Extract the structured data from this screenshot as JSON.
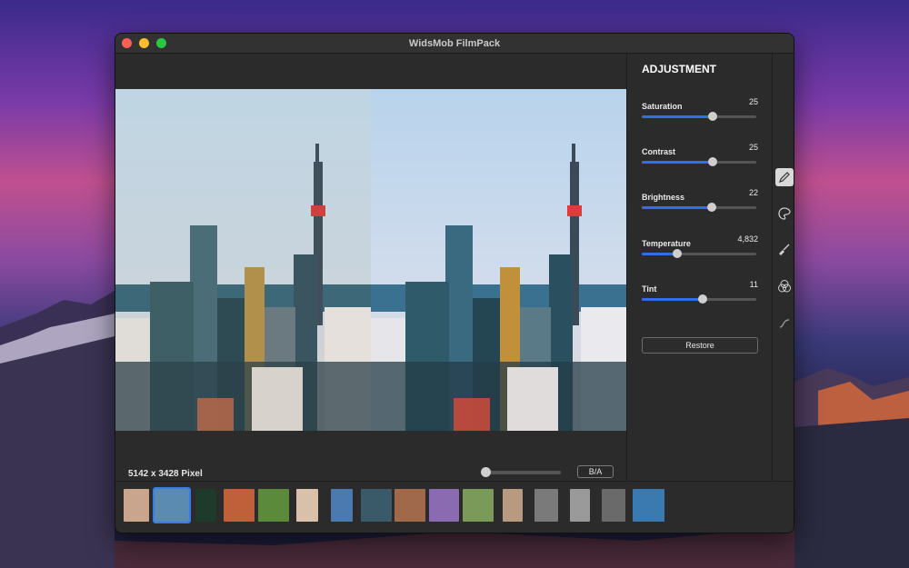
{
  "window": {
    "title": "WidsMob FilmPack"
  },
  "preview": {
    "dimensions_label": "5142 x 3428 Pixel",
    "ba_label": "B/A",
    "zoom_level": 0.0
  },
  "adjustment": {
    "title": "ADJUSTMENT",
    "params": [
      {
        "name": "Saturation",
        "value": "25",
        "fraction": 0.62
      },
      {
        "name": "Contrast",
        "value": "25",
        "fraction": 0.62
      },
      {
        "name": "Brightness",
        "value": "22",
        "fraction": 0.61
      },
      {
        "name": "Temperature",
        "value": "4,832",
        "fraction": 0.31
      },
      {
        "name": "Tint",
        "value": "11",
        "fraction": 0.53
      }
    ],
    "restore_label": "Restore"
  },
  "tools": [
    "pencil-icon",
    "palette-icon",
    "brush-icon",
    "color-circles-icon",
    "link-icon"
  ],
  "filmstrip": {
    "thumbs": [
      {
        "name": "portrait-girl",
        "color": "#c9a58e"
      },
      {
        "name": "city-skyline",
        "color": "#5b8bb0",
        "selected": true
      },
      {
        "name": "green-light",
        "color": "#1e3a2a"
      },
      {
        "name": "sunset-lake",
        "color": "#c0603a"
      },
      {
        "name": "green-field",
        "color": "#5a8a3a"
      },
      {
        "name": "portrait-woman",
        "color": "#d9c0a8"
      },
      {
        "name": "glass-building",
        "color": "#4a7ab0"
      },
      {
        "name": "coast",
        "color": "#3a5a6a"
      },
      {
        "name": "city-dusk",
        "color": "#a06a4a"
      },
      {
        "name": "purple-lake",
        "color": "#8a6ab0"
      },
      {
        "name": "mountain-lake",
        "color": "#7a9a5a"
      },
      {
        "name": "child-portrait",
        "color": "#b89a80"
      },
      {
        "name": "bw-street",
        "color": "#7a7a7a"
      },
      {
        "name": "bw-portrait",
        "color": "#9a9a9a"
      },
      {
        "name": "bw-scene",
        "color": "#6a6a6a"
      },
      {
        "name": "blue-lake",
        "color": "#3a7ab0"
      }
    ]
  }
}
